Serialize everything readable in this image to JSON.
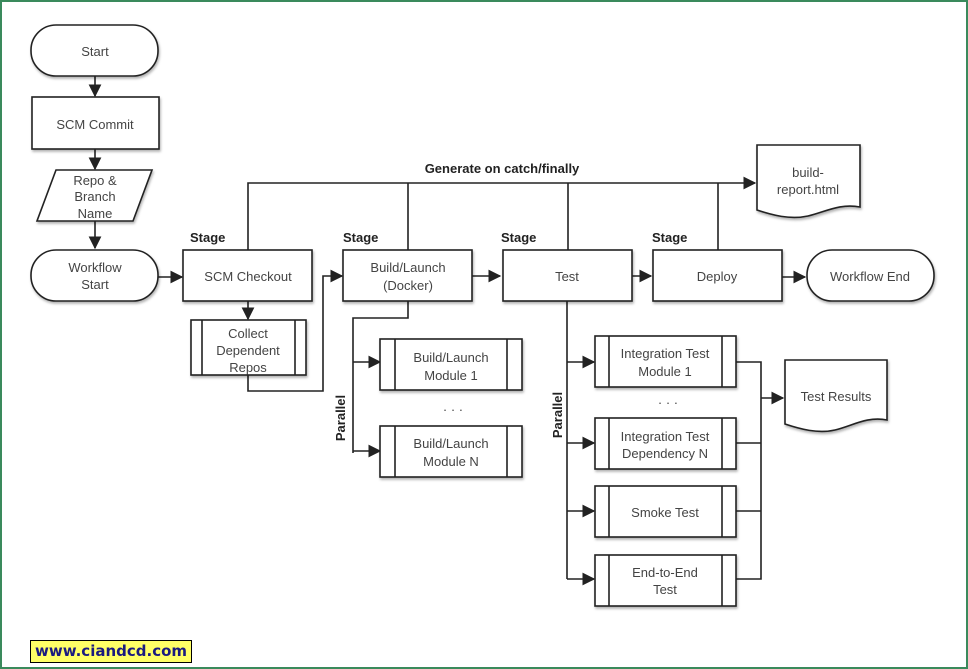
{
  "diagram": {
    "title_banner": "Generate on catch/finally",
    "stage_label": "Stage",
    "parallel_label": "Parallel",
    "ellipsis": "· · ·",
    "nodes": {
      "start": [
        "Start"
      ],
      "scm_commit": [
        "SCM Commit"
      ],
      "repo_branch": [
        "Repo &",
        "Branch",
        "Name"
      ],
      "workflow_start": [
        "Workflow",
        "Start"
      ],
      "scm_checkout": [
        "SCM Checkout"
      ],
      "collect_repos": [
        "Collect",
        "Dependent",
        "Repos"
      ],
      "build_launch": [
        "Build/Launch",
        "(Docker)"
      ],
      "build_module_1": [
        "Build/Launch",
        "Module 1"
      ],
      "build_module_n": [
        "Build/Launch",
        "Module N"
      ],
      "test": [
        "Test"
      ],
      "integration_module_1": [
        "Integration Test",
        "Module 1"
      ],
      "integration_dependency_n": [
        "Integration Test",
        "Dependency N"
      ],
      "smoke_test": [
        "Smoke Test"
      ],
      "end_to_end": [
        "End-to-End",
        "Test"
      ],
      "deploy": [
        "Deploy"
      ],
      "workflow_end": [
        "Workflow End"
      ],
      "build_report": [
        "build-",
        "report.html"
      ],
      "test_results": [
        "Test Results"
      ]
    }
  },
  "footer": {
    "website": "www.ciandcd.com"
  },
  "colors": {
    "frame_border": "#3a8a5c",
    "watermark_bg": "#ffff66",
    "watermark_text": "#1a1a80",
    "stroke": "#222222"
  }
}
